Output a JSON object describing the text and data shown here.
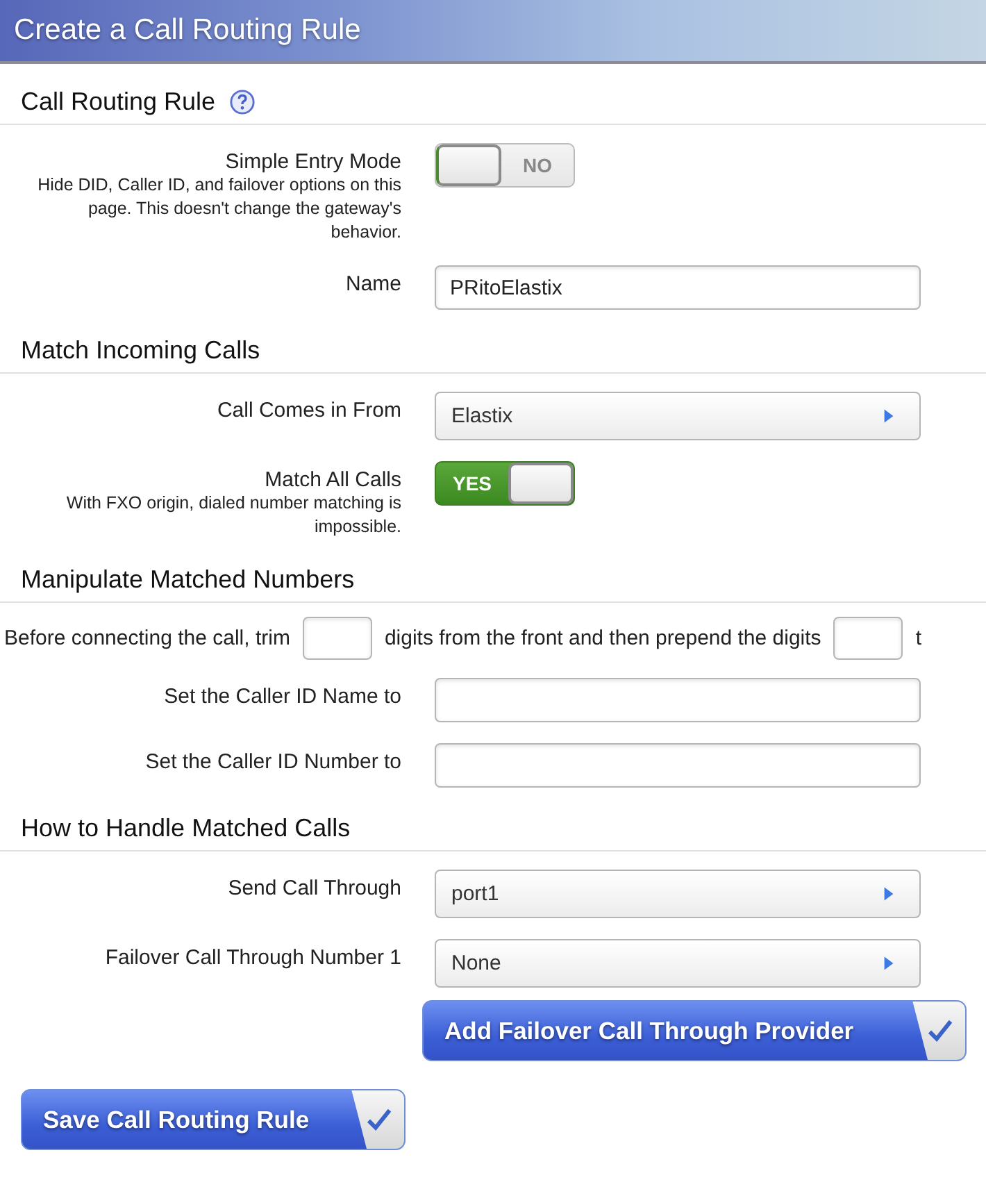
{
  "title": "Create a Call Routing Rule",
  "sections": [
    {
      "heading": "Call Routing Rule",
      "has_help": true,
      "fields": [
        {
          "kind": "toggle",
          "label": "Simple Entry Mode",
          "hint": "Hide DID, Caller ID, and failover options on this page. This doesn't change the gateway's behavior.",
          "on": false,
          "state_text": "NO"
        },
        {
          "kind": "text",
          "label": "Name",
          "value": "PRitoElastix"
        }
      ]
    },
    {
      "heading": "Match Incoming Calls",
      "has_help": false,
      "fields": [
        {
          "kind": "select",
          "label": "Call Comes in From",
          "value": "Elastix"
        },
        {
          "kind": "toggle",
          "label": "Match All Calls",
          "hint": "With FXO origin, dialed number matching is impossible.",
          "on": true,
          "state_text": "YES"
        }
      ]
    },
    {
      "heading": "Manipulate Matched Numbers",
      "has_help": false,
      "fields": [
        {
          "kind": "sentence",
          "parts": [
            "Before connecting the call, trim",
            "digits from the front and then prepend the digits",
            "t"
          ]
        },
        {
          "kind": "text",
          "label": "Set the Caller ID Name to"
        },
        {
          "kind": "text",
          "label": "Set the Caller ID Number to"
        }
      ]
    },
    {
      "heading": "How to Handle Matched Calls",
      "has_help": false,
      "fields": [
        {
          "kind": "select",
          "label": "Send Call Through",
          "value": "port1"
        },
        {
          "kind": "select",
          "label": "Failover Call Through Number 1",
          "value": "None"
        },
        {
          "kind": "button",
          "text": "Add Failover Call Through Provider"
        }
      ]
    }
  ],
  "save_button": "Save Call Routing Rule"
}
